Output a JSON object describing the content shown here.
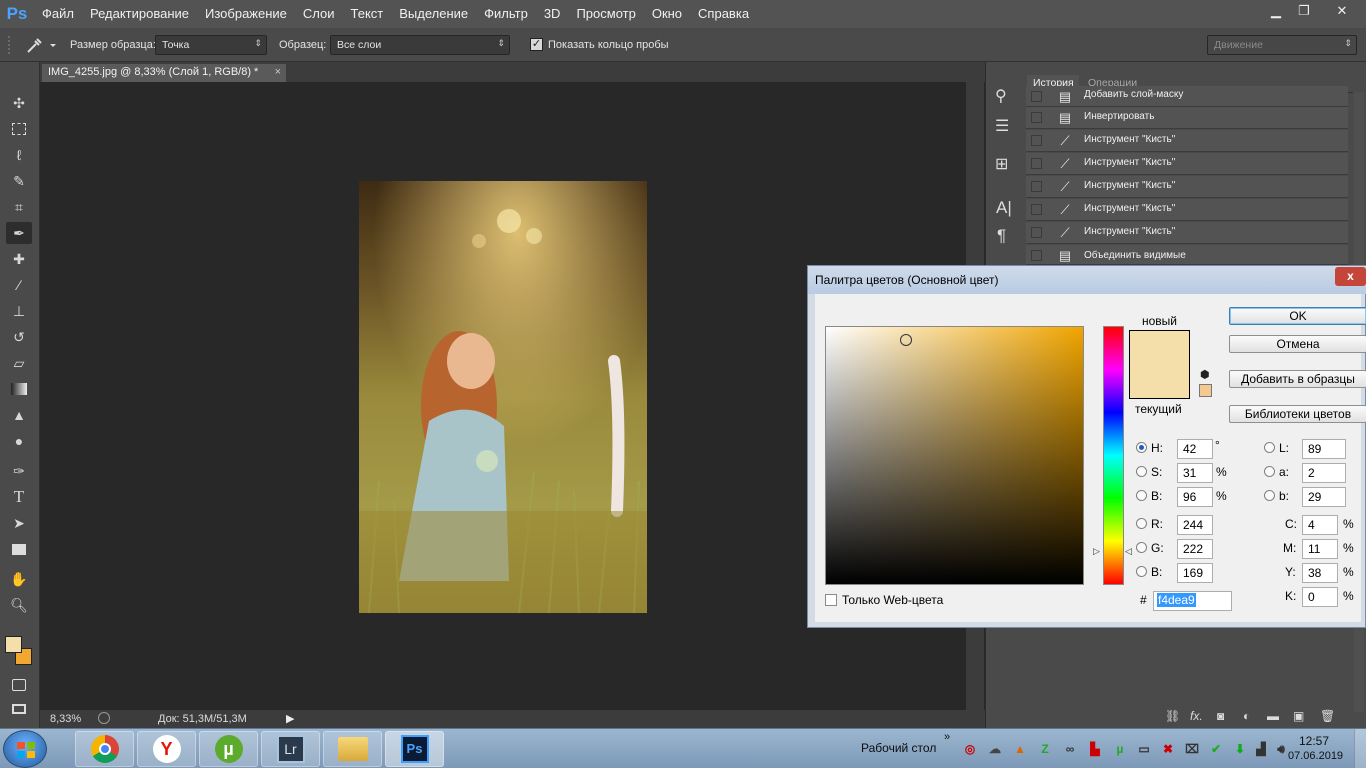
{
  "app": {
    "logo": "Ps",
    "title_doc": "IMG_4255.jpg @ 8,33% (Слой 1, RGB/8) *"
  },
  "menu": [
    "Файл",
    "Редактирование",
    "Изображение",
    "Слои",
    "Текст",
    "Выделение",
    "Фильтр",
    "3D",
    "Просмотр",
    "Окно",
    "Справка"
  ],
  "window_controls": {
    "minimize": "▁",
    "restore": "❐",
    "close": "✕"
  },
  "options": {
    "sample_size_label": "Размер образца:",
    "sample_size_value": "Точка",
    "sample_label": "Образец:",
    "sample_value": "Все слои",
    "show_ring_label": "Показать кольцо пробы",
    "show_ring_checked": true,
    "workspace": "Движение"
  },
  "status": {
    "zoom": "8,33%",
    "doc": "Док: 51,3M/51,3M"
  },
  "panel": {
    "tab_history": "История",
    "tab_actions": "Операции"
  },
  "history": [
    {
      "icon": "doc-icon",
      "label": "Добавить слой-маску"
    },
    {
      "icon": "doc-icon",
      "label": "Инвертировать"
    },
    {
      "icon": "brush-icon",
      "label": "Инструмент \"Кисть\""
    },
    {
      "icon": "brush-icon",
      "label": "Инструмент \"Кисть\""
    },
    {
      "icon": "brush-icon",
      "label": "Инструмент \"Кисть\""
    },
    {
      "icon": "brush-icon",
      "label": "Инструмент \"Кисть\""
    },
    {
      "icon": "brush-icon",
      "label": "Инструмент \"Кисть\""
    },
    {
      "icon": "doc-icon",
      "label": "Объединить видимые"
    }
  ],
  "dialog": {
    "title": "Палитра цветов (Основной цвет)",
    "close": "x",
    "new_label": "новый",
    "current_label": "текущий",
    "new_color": "#f4dea9",
    "current_color": "#f4c990",
    "ok": "OK",
    "cancel": "Отмена",
    "add_swatches": "Добавить в образцы",
    "libraries": "Библиотеки цветов",
    "web_only": "Только Web-цвета",
    "hsb": {
      "H": "42",
      "S": "31",
      "B": "96"
    },
    "rgb": {
      "R": "244",
      "G": "222",
      "B": "169"
    },
    "lab": {
      "L": "89",
      "a": "2",
      "b": "29"
    },
    "cmyk": {
      "C": "4",
      "M": "11",
      "Y": "38",
      "K": "0"
    },
    "labels": {
      "H": "H:",
      "S": "S:",
      "B": "B:",
      "R": "R:",
      "G": "G:",
      "B2": "B:",
      "L": "L:",
      "a": "a:",
      "b": "b:",
      "C": "C:",
      "M": "M:",
      "Y": "Y:",
      "K": "K:"
    },
    "units": {
      "deg": "°",
      "pct": "%"
    },
    "hex_label": "#",
    "hex": "f4dea9",
    "hue_color": "#f0a500"
  },
  "taskbar": {
    "desktop": "Рабочий стол",
    "time": "12:57",
    "date": "07.06.2019",
    "apps": [
      "chrome-icon",
      "yandex-icon",
      "utorrent-icon",
      "lightroom-icon",
      "folder-icon",
      "photoshop-icon"
    ],
    "app_glyphs": {
      "lr": "Lr",
      "ps": "Ps",
      "y": "Y",
      "u": "µ"
    }
  },
  "colors": {
    "fg": "#f4dea9",
    "bg": "#f0a830",
    "accent": "#4aa3ff"
  }
}
